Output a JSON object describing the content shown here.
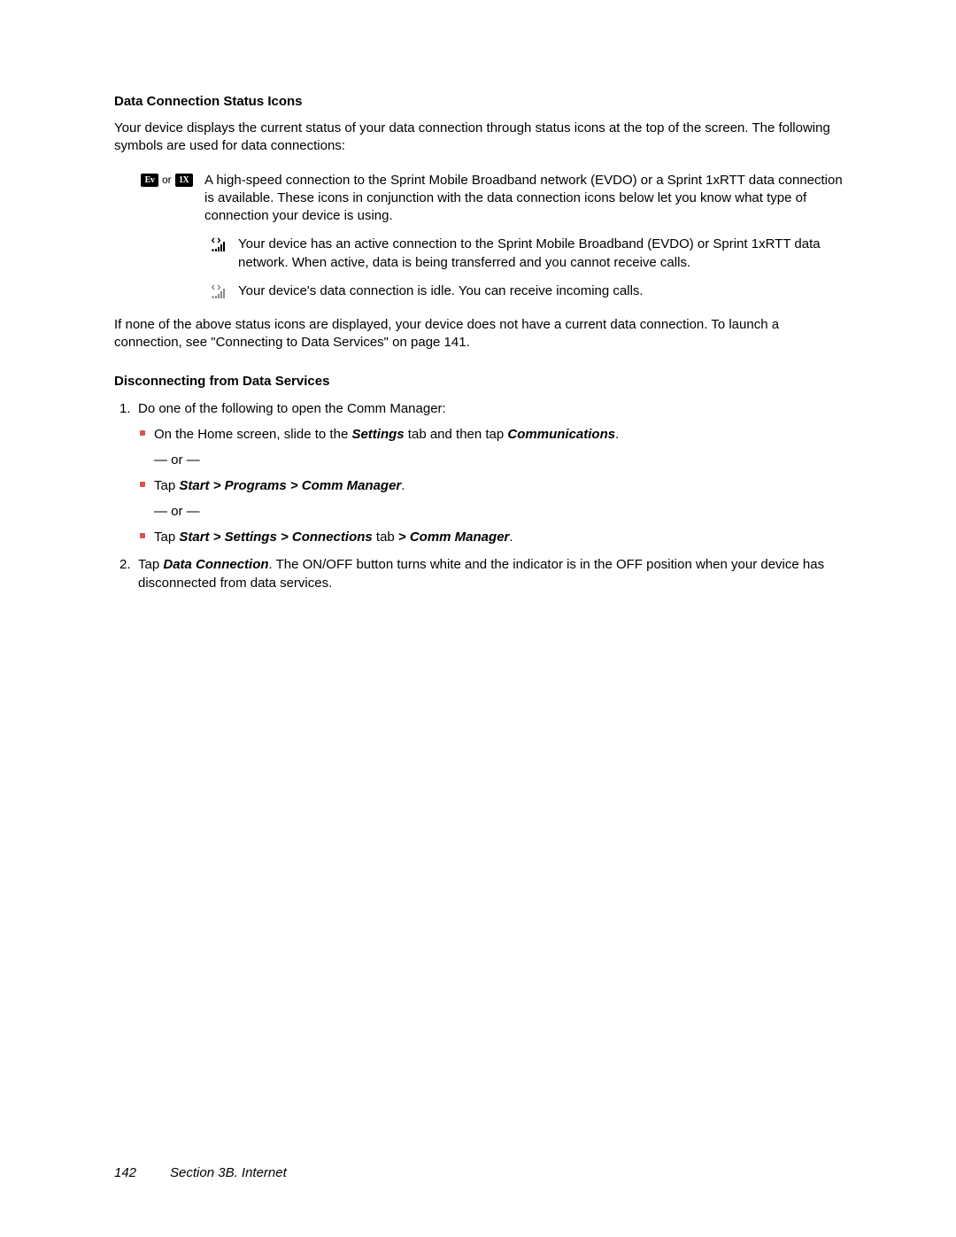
{
  "heading1": "Data Connection Status Icons",
  "intro": "Your device displays the current status of your data connection through status icons at the top of the screen. The following symbols are used for data connections:",
  "iconRow1": {
    "badge1": "Ev",
    "or": "or",
    "badge2": "1X",
    "desc": "A high-speed connection to the Sprint Mobile Broadband network (EVDO) or a Sprint 1xRTT data connection is available. These icons in conjunction with the data connection icons below let you know what type of connection your device is using."
  },
  "iconRow2": {
    "desc": "Your device has an active connection to the Sprint Mobile Broadband (EVDO) or Sprint 1xRTT data network. When active, data is being transferred and you cannot receive calls."
  },
  "iconRow3": {
    "desc": "Your device's data connection is idle. You can receive incoming calls."
  },
  "afterTable": "If none of the above status icons are displayed, your device does not have a current data connection. To launch a connection, see \"Connecting to Data Services\" on page 141.",
  "heading2": "Disconnecting from Data Services",
  "step1": {
    "lead": "Do one of the following to open the Comm Manager:",
    "b1_pre": "On the Home screen, slide to the ",
    "b1_em1": "Settings",
    "b1_mid": " tab and then tap ",
    "b1_em2": "Communications",
    "b1_end": ".",
    "or": "— or —",
    "b2_pre": "Tap ",
    "b2_em": "Start > Programs > Comm Manager",
    "b2_end": ".",
    "b3_pre": "Tap ",
    "b3_em1": "Start > Settings > Connections",
    "b3_mid": " tab ",
    "b3_em2": "> Comm Manager",
    "b3_end": "."
  },
  "step2": {
    "pre": "Tap ",
    "em": "Data Connection",
    "rest": ". The ON/OFF button turns white and the indicator is in the OFF position when your device has disconnected from data services."
  },
  "footer": {
    "page": "142",
    "section": "Section 3B. Internet"
  }
}
